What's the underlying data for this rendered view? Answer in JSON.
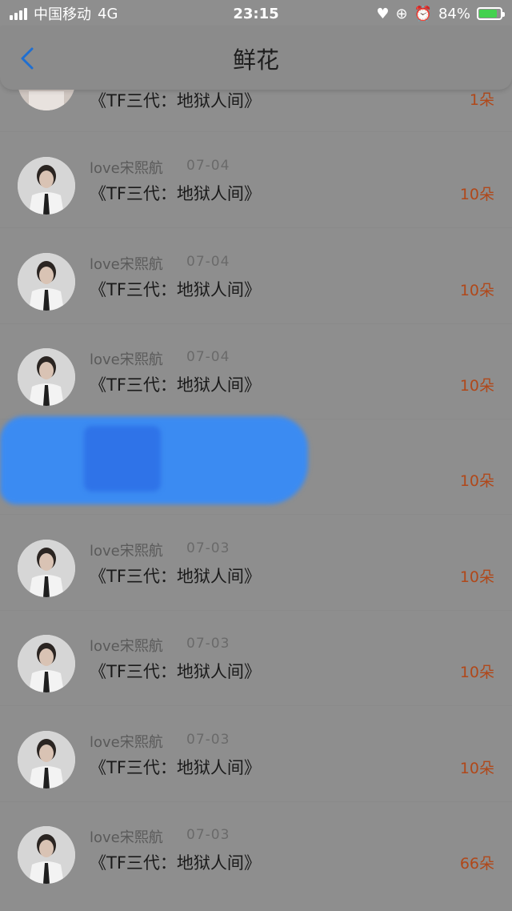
{
  "status_bar": {
    "carrier": "中国移动",
    "network": "4G",
    "time": "23:15",
    "battery": "84%",
    "icons": [
      "heart-icon",
      "orientation-lock-icon",
      "alarm-icon",
      "battery-charging-icon"
    ]
  },
  "nav": {
    "title": "鲜花",
    "back_icon": "chevron-left-icon"
  },
  "rows": [
    {
      "user": "",
      "date": "",
      "title": "《TF三代：地狱人间》",
      "amount": "1朵"
    },
    {
      "user": "love宋熙航",
      "date": "07-04",
      "title": "《TF三代：地狱人间》",
      "amount": "10朵"
    },
    {
      "user": "love宋熙航",
      "date": "07-04",
      "title": "《TF三代：地狱人间》",
      "amount": "10朵"
    },
    {
      "user": "love宋熙航",
      "date": "07-04",
      "title": "《TF三代：地狱人间》",
      "amount": "10朵"
    },
    {
      "user": "",
      "date": "",
      "title": "",
      "amount": "10朵"
    },
    {
      "user": "love宋熙航",
      "date": "07-03",
      "title": "《TF三代：地狱人间》",
      "amount": "10朵"
    },
    {
      "user": "love宋熙航",
      "date": "07-03",
      "title": "《TF三代：地狱人间》",
      "amount": "10朵"
    },
    {
      "user": "love宋熙航",
      "date": "07-03",
      "title": "《TF三代：地狱人间》",
      "amount": "10朵"
    },
    {
      "user": "love宋熙航",
      "date": "07-03",
      "title": "《TF三代：地狱人间》",
      "amount": "66朵"
    }
  ],
  "colors": {
    "amount": "#b0481a",
    "overlay": "#8e8e8e",
    "redaction": "#3b8bf2"
  }
}
